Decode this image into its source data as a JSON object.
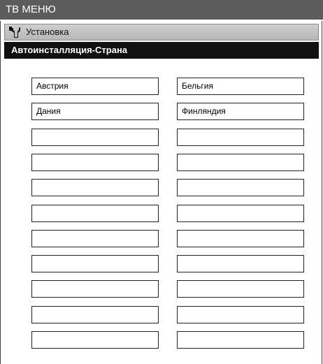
{
  "window": {
    "title": "ТВ МЕНЮ"
  },
  "section": {
    "label": "Установка",
    "icon": "wrench-icon"
  },
  "subtitle": "Автоинсталляция-Страна",
  "countries": [
    [
      "Австрия",
      "Бельгия"
    ],
    [
      "Дания",
      "Финляндия"
    ],
    [
      "",
      ""
    ],
    [
      "",
      ""
    ],
    [
      "",
      ""
    ],
    [
      "",
      ""
    ],
    [
      "",
      ""
    ],
    [
      "",
      ""
    ],
    [
      "",
      ""
    ],
    [
      "",
      ""
    ],
    [
      "",
      ""
    ]
  ],
  "colors": {
    "title_bg": "#5c5c5c",
    "section_bg": "#c4c4c4",
    "subtitle_bg": "#111111"
  }
}
